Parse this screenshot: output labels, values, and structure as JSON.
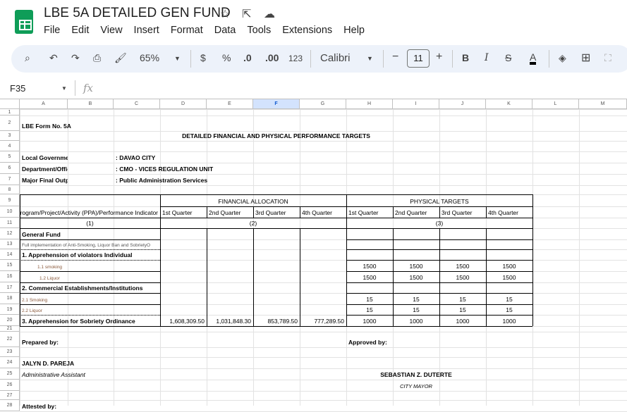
{
  "app": {
    "title": "LBE 5A DETAILED GEN FUND",
    "menu": [
      "File",
      "Edit",
      "View",
      "Insert",
      "Format",
      "Data",
      "Tools",
      "Extensions",
      "Help"
    ]
  },
  "toolbar": {
    "zoom": "65%",
    "currency": "$",
    "percent": "%",
    "decrease_decimal": ".0",
    "increase_decimal": ".00",
    "number_format": "123",
    "font": "Calibri",
    "font_size": "11",
    "bold": "B",
    "italic": "I",
    "text_color": "A"
  },
  "formula_bar": {
    "name_box": "F35",
    "fx": "fx",
    "value": ""
  },
  "columns": [
    "A",
    "B",
    "C",
    "D",
    "E",
    "F",
    "G",
    "H",
    "I",
    "J",
    "K",
    "L",
    "M"
  ],
  "selected_column": "F",
  "rows": [
    1,
    2,
    3,
    4,
    5,
    6,
    7,
    8,
    9,
    10,
    11,
    12,
    13,
    14,
    15,
    16,
    17,
    18,
    19,
    20,
    21,
    22,
    23,
    24,
    25,
    26,
    27,
    28
  ],
  "cells": [
    {
      "cell": "A2",
      "text": "LBE Form No. 5A"
    },
    {
      "cell": "A3",
      "text": "DETAILED FINANCIAL AND PHYSICAL PERFORMANCE TARGETS"
    },
    {
      "cell": "A5",
      "text": "Local Government Unit"
    },
    {
      "cell": "C5",
      "text": ": DAVAO CITY"
    },
    {
      "cell": "A6",
      "text": "Department/Office"
    },
    {
      "cell": "C6",
      "text": ": CMO - VICES REGULATION UNIT"
    },
    {
      "cell": "A7",
      "text": "Major Final Output"
    },
    {
      "cell": "C7",
      "text": ": Public Administration Services"
    },
    {
      "cell": "D9",
      "text": "FINANCIAL ALLOCATION"
    },
    {
      "cell": "H9",
      "text": "PHYSICAL TARGETS"
    },
    {
      "cell": "A10",
      "text": "Program/Project/Activity (PPA)/Performance Indicator"
    },
    {
      "cell": "D10",
      "text": "1st Quarter"
    },
    {
      "cell": "E10",
      "text": "2nd Quarter"
    },
    {
      "cell": "F10",
      "text": "3rd Quarter"
    },
    {
      "cell": "G10",
      "text": "4th Quarter"
    },
    {
      "cell": "H10",
      "text": "1st Quarter"
    },
    {
      "cell": "I10",
      "text": "2nd Quarter"
    },
    {
      "cell": "J10",
      "text": "3rd Quarter"
    },
    {
      "cell": "K10",
      "text": "4th Quarter"
    },
    {
      "cell": "A11",
      "text": "(1)"
    },
    {
      "cell": "D11",
      "text": "(2)"
    },
    {
      "cell": "H11",
      "text": "(3)"
    },
    {
      "cell": "A12",
      "text": "General Fund"
    },
    {
      "cell": "A13",
      "text": "Full implementation of Anti-Smoking, Liquor Ban and SobrietyO"
    },
    {
      "cell": "A14",
      "text": "1.  Apprehension of violators Individual"
    },
    {
      "cell": "A15",
      "text": "1.1 smoking"
    },
    {
      "cell": "H15",
      "text": "1500"
    },
    {
      "cell": "I15",
      "text": "1500"
    },
    {
      "cell": "J15",
      "text": "1500"
    },
    {
      "cell": "K15",
      "text": "1500"
    },
    {
      "cell": "A16",
      "text": "1.2 Liquor"
    },
    {
      "cell": "H16",
      "text": "1500"
    },
    {
      "cell": "I16",
      "text": "1500"
    },
    {
      "cell": "J16",
      "text": "1500"
    },
    {
      "cell": "K16",
      "text": "1500"
    },
    {
      "cell": "A17",
      "text": "2.  Commercial Establishments/Institutions"
    },
    {
      "cell": "A18",
      "text": "2.1   Smoking"
    },
    {
      "cell": "H18",
      "text": "15"
    },
    {
      "cell": "I18",
      "text": "15"
    },
    {
      "cell": "J18",
      "text": "15"
    },
    {
      "cell": "K18",
      "text": "15"
    },
    {
      "cell": "A19",
      "text": "2.2   Liquor"
    },
    {
      "cell": "H19",
      "text": "15"
    },
    {
      "cell": "I19",
      "text": "15"
    },
    {
      "cell": "J19",
      "text": "15"
    },
    {
      "cell": "K19",
      "text": "15"
    },
    {
      "cell": "A20",
      "text": "3. Apprehension for Sobriety Ordinance"
    },
    {
      "cell": "D20",
      "text": "1,608,309.50"
    },
    {
      "cell": "E20",
      "text": "1,031,848.30"
    },
    {
      "cell": "F20",
      "text": "853,789.50"
    },
    {
      "cell": "G20",
      "text": "777,289.50"
    },
    {
      "cell": "H20",
      "text": "1000"
    },
    {
      "cell": "I20",
      "text": "1000"
    },
    {
      "cell": "J20",
      "text": "1000"
    },
    {
      "cell": "K20",
      "text": "1000"
    },
    {
      "cell": "A22",
      "text": "Prepared by:"
    },
    {
      "cell": "H22",
      "text": "Approved by:"
    },
    {
      "cell": "A24",
      "text": "JALYN D. PAREJA"
    },
    {
      "cell": "A25",
      "text": "Administrative Assistant"
    },
    {
      "cell": "H25",
      "text": "SEBASTIAN Z. DUTERTE"
    },
    {
      "cell": "H26",
      "text": "CITY MAYOR"
    },
    {
      "cell": "A28",
      "text": "Attested by:"
    }
  ]
}
